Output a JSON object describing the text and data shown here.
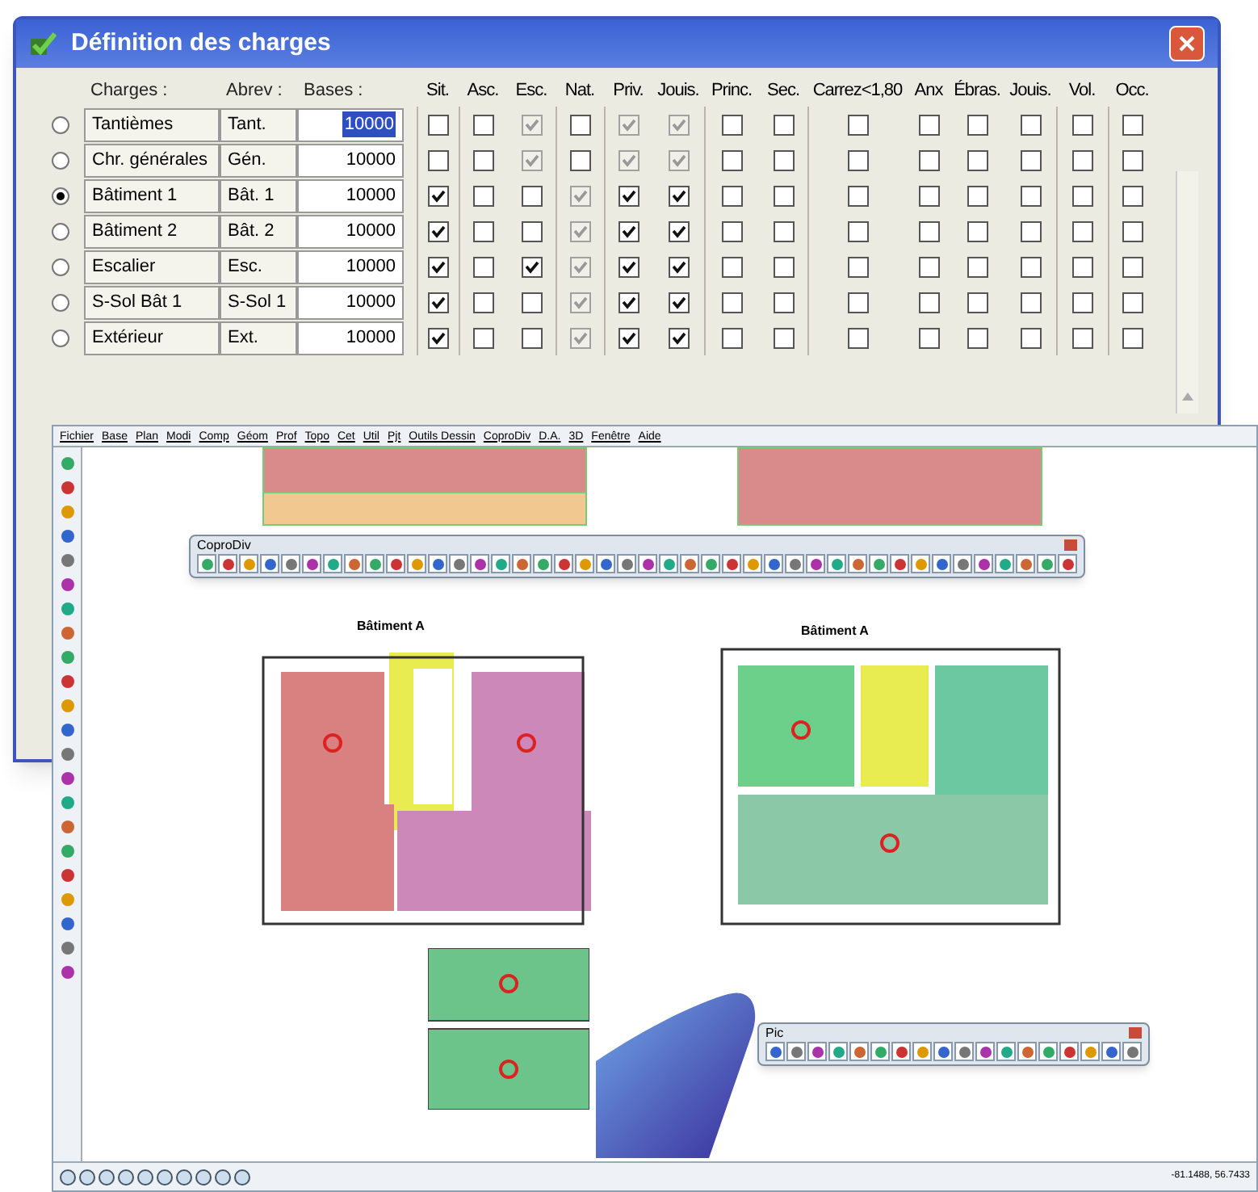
{
  "dialog": {
    "title": "Définition des charges",
    "columns": {
      "charges": "Charges :",
      "abrev": "Abrev :",
      "bases": "Bases :"
    },
    "check_columns": [
      "Sit.",
      "Asc.",
      "Esc.",
      "Nat.",
      "Priv.",
      "Jouis.",
      "Princ.",
      "Sec.",
      "Carrez<1,80",
      "Anx",
      "Ébras.",
      "Jouis.",
      "Vol.",
      "Occ."
    ],
    "rows": [
      {
        "selected": false,
        "name": "Tantièmes",
        "abrev": "Tant.",
        "base": "10000",
        "focused": true,
        "checks": [
          {
            "checked": false,
            "disabled": false
          },
          {
            "checked": false,
            "disabled": false
          },
          {
            "checked": true,
            "disabled": true
          },
          {
            "checked": false,
            "disabled": false
          },
          {
            "checked": true,
            "disabled": true
          },
          {
            "checked": true,
            "disabled": true
          },
          {
            "checked": false,
            "disabled": false
          },
          {
            "checked": false,
            "disabled": false
          },
          {
            "checked": false,
            "disabled": false
          },
          {
            "checked": false,
            "disabled": false
          },
          {
            "checked": false,
            "disabled": false
          },
          {
            "checked": false,
            "disabled": false
          },
          {
            "checked": false,
            "disabled": false
          },
          {
            "checked": false,
            "disabled": false
          }
        ]
      },
      {
        "selected": false,
        "name": "Chr. générales",
        "abrev": "Gén.",
        "base": "10000",
        "focused": false,
        "checks": [
          {
            "checked": false,
            "disabled": false
          },
          {
            "checked": false,
            "disabled": false
          },
          {
            "checked": true,
            "disabled": true
          },
          {
            "checked": false,
            "disabled": false
          },
          {
            "checked": true,
            "disabled": true
          },
          {
            "checked": true,
            "disabled": true
          },
          {
            "checked": false,
            "disabled": false
          },
          {
            "checked": false,
            "disabled": false
          },
          {
            "checked": false,
            "disabled": false
          },
          {
            "checked": false,
            "disabled": false
          },
          {
            "checked": false,
            "disabled": false
          },
          {
            "checked": false,
            "disabled": false
          },
          {
            "checked": false,
            "disabled": false
          },
          {
            "checked": false,
            "disabled": false
          }
        ]
      },
      {
        "selected": true,
        "name": "Bâtiment 1",
        "abrev": "Bât. 1",
        "base": "10000",
        "focused": false,
        "checks": [
          {
            "checked": true,
            "disabled": false
          },
          {
            "checked": false,
            "disabled": false
          },
          {
            "checked": false,
            "disabled": false
          },
          {
            "checked": true,
            "disabled": true
          },
          {
            "checked": true,
            "disabled": false
          },
          {
            "checked": true,
            "disabled": false
          },
          {
            "checked": false,
            "disabled": false
          },
          {
            "checked": false,
            "disabled": false
          },
          {
            "checked": false,
            "disabled": false
          },
          {
            "checked": false,
            "disabled": false
          },
          {
            "checked": false,
            "disabled": false
          },
          {
            "checked": false,
            "disabled": false
          },
          {
            "checked": false,
            "disabled": false
          },
          {
            "checked": false,
            "disabled": false
          }
        ]
      },
      {
        "selected": false,
        "name": "Bâtiment 2",
        "abrev": "Bât. 2",
        "base": "10000",
        "focused": false,
        "checks": [
          {
            "checked": true,
            "disabled": false
          },
          {
            "checked": false,
            "disabled": false
          },
          {
            "checked": false,
            "disabled": false
          },
          {
            "checked": true,
            "disabled": true
          },
          {
            "checked": true,
            "disabled": false
          },
          {
            "checked": true,
            "disabled": false
          },
          {
            "checked": false,
            "disabled": false
          },
          {
            "checked": false,
            "disabled": false
          },
          {
            "checked": false,
            "disabled": false
          },
          {
            "checked": false,
            "disabled": false
          },
          {
            "checked": false,
            "disabled": false
          },
          {
            "checked": false,
            "disabled": false
          },
          {
            "checked": false,
            "disabled": false
          },
          {
            "checked": false,
            "disabled": false
          }
        ]
      },
      {
        "selected": false,
        "name": "Escalier",
        "abrev": "Esc.",
        "base": "10000",
        "focused": false,
        "checks": [
          {
            "checked": true,
            "disabled": false
          },
          {
            "checked": false,
            "disabled": false
          },
          {
            "checked": true,
            "disabled": false
          },
          {
            "checked": true,
            "disabled": true
          },
          {
            "checked": true,
            "disabled": false
          },
          {
            "checked": true,
            "disabled": false
          },
          {
            "checked": false,
            "disabled": false
          },
          {
            "checked": false,
            "disabled": false
          },
          {
            "checked": false,
            "disabled": false
          },
          {
            "checked": false,
            "disabled": false
          },
          {
            "checked": false,
            "disabled": false
          },
          {
            "checked": false,
            "disabled": false
          },
          {
            "checked": false,
            "disabled": false
          },
          {
            "checked": false,
            "disabled": false
          }
        ]
      },
      {
        "selected": false,
        "name": "S-Sol Bât 1",
        "abrev": "S-Sol 1",
        "base": "10000",
        "focused": false,
        "checks": [
          {
            "checked": true,
            "disabled": false
          },
          {
            "checked": false,
            "disabled": false
          },
          {
            "checked": false,
            "disabled": false
          },
          {
            "checked": true,
            "disabled": true
          },
          {
            "checked": true,
            "disabled": false
          },
          {
            "checked": true,
            "disabled": false
          },
          {
            "checked": false,
            "disabled": false
          },
          {
            "checked": false,
            "disabled": false
          },
          {
            "checked": false,
            "disabled": false
          },
          {
            "checked": false,
            "disabled": false
          },
          {
            "checked": false,
            "disabled": false
          },
          {
            "checked": false,
            "disabled": false
          },
          {
            "checked": false,
            "disabled": false
          },
          {
            "checked": false,
            "disabled": false
          }
        ]
      },
      {
        "selected": false,
        "name": "Extérieur",
        "abrev": "Ext.",
        "base": "10000",
        "focused": false,
        "checks": [
          {
            "checked": true,
            "disabled": false
          },
          {
            "checked": false,
            "disabled": false
          },
          {
            "checked": false,
            "disabled": false
          },
          {
            "checked": true,
            "disabled": true
          },
          {
            "checked": true,
            "disabled": false
          },
          {
            "checked": true,
            "disabled": false
          },
          {
            "checked": false,
            "disabled": false
          },
          {
            "checked": false,
            "disabled": false
          },
          {
            "checked": false,
            "disabled": false
          },
          {
            "checked": false,
            "disabled": false
          },
          {
            "checked": false,
            "disabled": false
          },
          {
            "checked": false,
            "disabled": false
          },
          {
            "checked": false,
            "disabled": false
          },
          {
            "checked": false,
            "disabled": false
          }
        ]
      }
    ]
  },
  "cad_window": {
    "menu": [
      "Fichier",
      "Base",
      "Plan",
      "Modi",
      "Comp",
      "Géom",
      "Prof",
      "Topo",
      "Cet",
      "Util",
      "Pjt",
      "Outils Dessin",
      "CoproDiv",
      "D.A.",
      "3D",
      "Fenêtre",
      "Aide"
    ],
    "plan_labels": [
      "Bâtiment A",
      "Bâtiment A"
    ],
    "toolbars": [
      {
        "title": "CoproDiv"
      },
      {
        "title": "Pic"
      }
    ],
    "status": "-81.1488, 56.7433"
  }
}
